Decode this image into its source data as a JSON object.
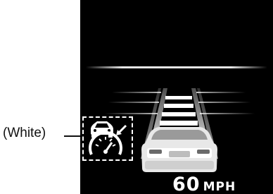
{
  "callout": {
    "label": "(White)"
  },
  "display": {
    "speed": {
      "value": "60",
      "unit": "MPH"
    },
    "icons": {
      "indicator": "cruise-control-vehicle-distance-icon",
      "vehicle": "own-vehicle-rear-view-icon",
      "lanes": "lane-lines-graphic"
    },
    "colors": {
      "background": "#000000",
      "foreground": "#ffffff"
    }
  }
}
